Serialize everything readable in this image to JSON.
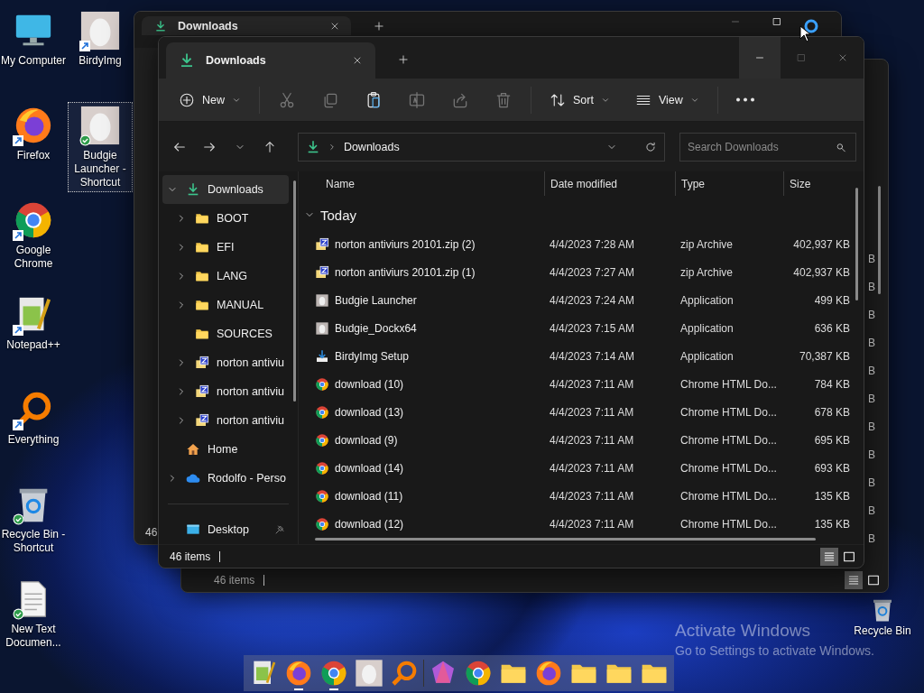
{
  "desktop": {
    "icons": [
      {
        "label": "My Computer",
        "kind": "monitor",
        "shortcut": false,
        "synced": false,
        "selected": false
      },
      {
        "label": "Firefox",
        "kind": "firefox",
        "shortcut": true,
        "synced": false,
        "selected": false
      },
      {
        "label": "Google Chrome",
        "kind": "chrome",
        "shortcut": true,
        "synced": false,
        "selected": false
      },
      {
        "label": "Notepad++",
        "kind": "notepad",
        "shortcut": true,
        "synced": false,
        "selected": false
      },
      {
        "label": "Everything",
        "kind": "everything",
        "shortcut": true,
        "synced": false,
        "selected": false
      },
      {
        "label": "Recycle Bin - Shortcut",
        "kind": "recycle",
        "shortcut": false,
        "synced": true,
        "selected": false
      },
      {
        "label": "New Text Documen...",
        "kind": "textdoc",
        "shortcut": false,
        "synced": true,
        "selected": false
      },
      {
        "label": "BirdyImg",
        "kind": "photo",
        "shortcut": true,
        "synced": false,
        "selected": false
      },
      {
        "label": "Budgie Launcher - Shortcut",
        "kind": "photo",
        "shortcut": false,
        "synced": true,
        "selected": true
      }
    ],
    "recycle_bin": {
      "label": "Recycle Bin"
    },
    "activation": {
      "title": "Activate Windows",
      "subtitle": "Go to Settings to activate Windows."
    }
  },
  "back_window": {
    "tab": "Downloads",
    "status": "46"
  },
  "middle_window": {
    "status": "46 items",
    "size_fragments": [
      "B",
      "B",
      "B",
      "B",
      "B",
      "B",
      "B",
      "B",
      "B",
      "B",
      "B"
    ],
    "view_modes": [
      {
        "kind": "details",
        "selected": true
      },
      {
        "kind": "tiles",
        "selected": false
      }
    ]
  },
  "window": {
    "tab": "Downloads",
    "toolbar": [
      {
        "kind": "new",
        "label": "New",
        "disabled": false
      },
      {
        "kind": "separator"
      },
      {
        "kind": "cut",
        "disabled": true
      },
      {
        "kind": "copy",
        "disabled": true
      },
      {
        "kind": "paste",
        "disabled": false
      },
      {
        "kind": "rename",
        "disabled": true
      },
      {
        "kind": "share",
        "disabled": true
      },
      {
        "kind": "delete",
        "disabled": true
      },
      {
        "kind": "separator"
      },
      {
        "kind": "sort",
        "label": "Sort",
        "disabled": false
      },
      {
        "kind": "view",
        "label": "View",
        "disabled": false
      },
      {
        "kind": "separator"
      },
      {
        "kind": "more",
        "disabled": false
      }
    ],
    "address": {
      "path": "Downloads"
    },
    "search": {
      "placeholder": "Search Downloads"
    },
    "sidebar": {
      "items": [
        {
          "label": "Downloads",
          "kind": "downloads",
          "expanded": true,
          "selected": true,
          "children": [
            {
              "label": "BOOT",
              "kind": "folder",
              "expanded": false,
              "selected": false
            },
            {
              "label": "EFI",
              "kind": "folder",
              "expanded": false,
              "selected": false
            },
            {
              "label": "LANG",
              "kind": "folder",
              "expanded": false,
              "selected": false
            },
            {
              "label": "MANUAL",
              "kind": "folder",
              "expanded": false,
              "selected": false
            },
            {
              "label": "SOURCES",
              "kind": "folder",
              "selected": false
            },
            {
              "label": "norton antiviu",
              "kind": "zip",
              "expanded": false,
              "selected": false
            },
            {
              "label": "norton antiviu",
              "kind": "zip",
              "expanded": false,
              "selected": false
            },
            {
              "label": "norton antiviu",
              "kind": "zip",
              "expanded": false,
              "selected": false
            }
          ]
        },
        {
          "label": "Home",
          "kind": "home",
          "selected": false
        },
        {
          "label": "Rodolfo - Perso",
          "kind": "cloud",
          "expanded": false,
          "selected": false
        }
      ],
      "pinned": [
        {
          "label": "Desktop",
          "kind": "desktop",
          "pinned": true
        }
      ]
    },
    "table": {
      "columns": [
        "Name",
        "Date modified",
        "Type",
        "Size"
      ],
      "groups": [
        {
          "label": "Today",
          "expanded": true,
          "rows": [
            {
              "name": "norton antiviurs 20101.zip (2)",
              "kind": "zip",
              "date": "4/4/2023 7:28 AM",
              "type": "zip Archive",
              "size": "402,937 KB"
            },
            {
              "name": "norton antiviurs 20101.zip (1)",
              "kind": "zip",
              "date": "4/4/2023 7:27 AM",
              "type": "zip Archive",
              "size": "402,937 KB"
            },
            {
              "name": "Budgie Launcher",
              "kind": "app",
              "date": "4/4/2023 7:24 AM",
              "type": "Application",
              "size": "499 KB"
            },
            {
              "name": "Budgie_Dockx64",
              "kind": "app",
              "date": "4/4/2023 7:15 AM",
              "type": "Application",
              "size": "636 KB"
            },
            {
              "name": "BirdyImg Setup",
              "kind": "installer",
              "date": "4/4/2023 7:14 AM",
              "type": "Application",
              "size": "70,387 KB"
            },
            {
              "name": "download (10)",
              "kind": "html",
              "date": "4/4/2023 7:11 AM",
              "type": "Chrome HTML Do...",
              "size": "784 KB"
            },
            {
              "name": "download (13)",
              "kind": "html",
              "date": "4/4/2023 7:11 AM",
              "type": "Chrome HTML Do...",
              "size": "678 KB"
            },
            {
              "name": "download (9)",
              "kind": "html",
              "date": "4/4/2023 7:11 AM",
              "type": "Chrome HTML Do...",
              "size": "695 KB"
            },
            {
              "name": "download (14)",
              "kind": "html",
              "date": "4/4/2023 7:11 AM",
              "type": "Chrome HTML Do...",
              "size": "693 KB"
            },
            {
              "name": "download (11)",
              "kind": "html",
              "date": "4/4/2023 7:11 AM",
              "type": "Chrome HTML Do...",
              "size": "135 KB"
            },
            {
              "name": "download (12)",
              "kind": "html",
              "date": "4/4/2023 7:11 AM",
              "type": "Chrome HTML Do...",
              "size": "135 KB"
            }
          ]
        }
      ]
    },
    "status": "46 items",
    "view_modes": [
      {
        "kind": "details",
        "selected": true
      },
      {
        "kind": "tiles",
        "selected": false
      }
    ]
  },
  "taskbar": {
    "items": [
      {
        "kind": "notepad",
        "running": false
      },
      {
        "kind": "firefox",
        "running": true
      },
      {
        "kind": "chrome",
        "running": true
      },
      {
        "kind": "photo",
        "running": false
      },
      {
        "kind": "everything",
        "running": false
      },
      {
        "kind": "separator"
      },
      {
        "kind": "gem",
        "running": false
      },
      {
        "kind": "chrome",
        "running": false
      },
      {
        "kind": "folder",
        "running": false
      },
      {
        "kind": "firefox",
        "running": false
      },
      {
        "kind": "folder",
        "running": false
      },
      {
        "kind": "folder",
        "running": false
      },
      {
        "kind": "folder",
        "running": false
      }
    ]
  }
}
